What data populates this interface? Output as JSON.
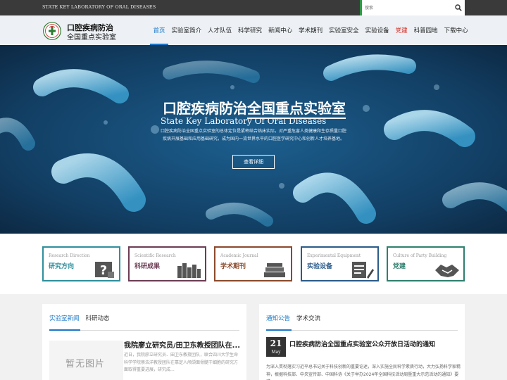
{
  "topbar": {
    "lab_name": "STATE KEY LABORATORY OF ORAL DISEASES",
    "search_placeholder": "搜索",
    "accent": "#2e9a44"
  },
  "header": {
    "logo_line1": "口腔疾病防治",
    "logo_line2": "全国重点实验室",
    "nav": [
      {
        "label": "首页"
      },
      {
        "label": "实验室简介"
      },
      {
        "label": "人才队伍"
      },
      {
        "label": "科学研究"
      },
      {
        "label": "新闻中心"
      },
      {
        "label": "学术期刊"
      },
      {
        "label": "实验室安全"
      },
      {
        "label": "实验设备"
      },
      {
        "label": "党建"
      },
      {
        "label": "科普园地"
      },
      {
        "label": "下载中心"
      }
    ],
    "active_color": "#1a78c8",
    "party_color": "#d9261c"
  },
  "hero": {
    "title": "口腔疾病防治全国重点实验室",
    "subtitle": "State Key Laboratory Of Oral Diseases",
    "description": "口腔疾病防治全国重点实验室的总体定位是紧密结合临床实际，对严重危害人类健康和生存质量口腔疾病开展基础和应用基础研究，成为国内一流世界水平的口腔医学研究中心和创新人才培养基地。",
    "button": "查看详细"
  },
  "cards": [
    {
      "en": "Research Direction",
      "zh": "研究方向",
      "color": "#2f8f9d",
      "icon": "question-board-icon"
    },
    {
      "en": "Scientific Research",
      "zh": "科研成果",
      "color": "#6c3c54",
      "icon": "books-icon"
    },
    {
      "en": "Academic Journal",
      "zh": "学术期刊",
      "color": "#8b4a2b",
      "icon": "book-stack-icon"
    },
    {
      "en": "Experimental Equipment",
      "zh": "实验设备",
      "color": "#2b5c8a",
      "icon": "document-pen-icon"
    },
    {
      "en": "Culture of Party Building",
      "zh": "党建",
      "color": "#2e7f6e",
      "icon": "handshake-icon"
    }
  ],
  "news": {
    "tabs": [
      "实验室新闻",
      "科研动态"
    ],
    "thumb_text": "暂无图片",
    "title": "我院廖立研究员/田卫东教授团队在...",
    "desc": "近日，我院廖立研究员、田卫东教授团队，联合四川大学生命科学学院蔡浩洋教授团队在靠定人颅颌面骨髓干细胞的研究方面取得重要进展，研究成..."
  },
  "notice": {
    "tabs": [
      "通知公告",
      "学术交流"
    ],
    "day": "21",
    "month": "May",
    "title": "口腔疾病防治全国重点实验室公众开放日活动的通知",
    "desc": "为深入贯彻落实习近平总书记关于科技创新的重要论述，深入实施全民科学素质行动，大力弘扬科学家精神，根据科技部、中央宣传部、中国科协《关于举办2024年全国科技活动周暨重大示范活动的通知》要求..."
  }
}
